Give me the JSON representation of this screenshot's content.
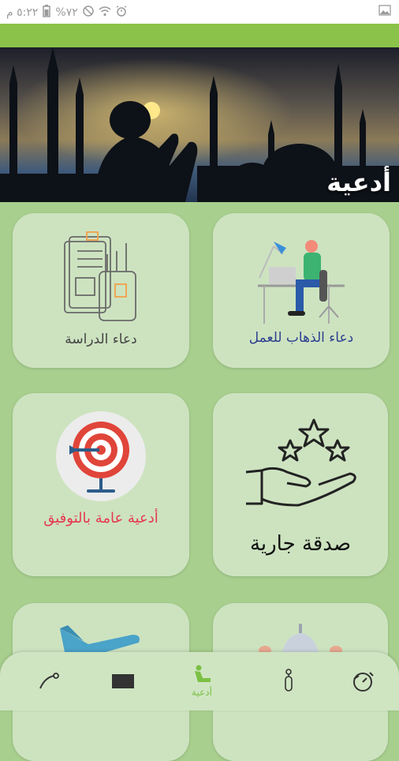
{
  "status": {
    "time": "٥:٢٢ م",
    "battery": "%٧٢"
  },
  "hero": {
    "title": "أدعية"
  },
  "cards": [
    {
      "label": "دعاء الذهاب للعمل",
      "color": "#2c3e8f"
    },
    {
      "label": "دعاء الدراسة",
      "color": "#444444"
    },
    {
      "label": "صدقة جارية",
      "color": "#111111"
    },
    {
      "label": "أدعية عامة بالتوفيق",
      "color": "#e53950"
    }
  ],
  "nav": {
    "active_label": "أدعية",
    "active_color": "#7cc043"
  }
}
